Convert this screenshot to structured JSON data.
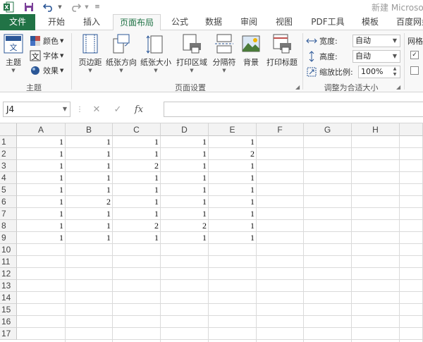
{
  "window": {
    "title": "新建 Microsoft"
  },
  "quick_access": {
    "app_icon": "excel-icon",
    "save_icon": "save-icon",
    "undo_icon": "undo-icon",
    "redo_icon": "redo-icon",
    "customize_icon": "customize-icon"
  },
  "tabs": [
    {
      "label": "文件"
    },
    {
      "label": "开始"
    },
    {
      "label": "插入"
    },
    {
      "label": "页面布局"
    },
    {
      "label": "公式"
    },
    {
      "label": "数据"
    },
    {
      "label": "审阅"
    },
    {
      "label": "视图"
    },
    {
      "label": "PDF工具"
    },
    {
      "label": "模板"
    },
    {
      "label": "百度网盘"
    }
  ],
  "ribbon": {
    "themes": {
      "theme_label": "主题",
      "colors_label": "颜色",
      "fonts_label": "字体",
      "effects_label": "效果",
      "group_label": "主题"
    },
    "page_setup": {
      "margins_label": "页边距",
      "orientation_label": "纸张方向",
      "size_label": "纸张大小",
      "print_area_label": "打印区域",
      "breaks_label": "分隔符",
      "background_label": "背景",
      "print_titles_label": "打印标题",
      "group_label": "页面设置"
    },
    "scale_to_fit": {
      "width_label": "宽度:",
      "width_value": "自动",
      "height_label": "高度:",
      "height_value": "自动",
      "scale_label": "缩放比例:",
      "scale_value": "100%",
      "group_label": "调整为合适大小"
    },
    "sheet_options": {
      "gridlines_label": "网格"
    }
  },
  "formula_bar": {
    "name_box": "J4",
    "cancel_glyph": "✕",
    "enter_glyph": "✓",
    "fx_label": "fx",
    "formula": ""
  },
  "sheet": {
    "columns": [
      "A",
      "B",
      "C",
      "D",
      "E",
      "F",
      "G",
      "H"
    ],
    "rows": [
      "1",
      "2",
      "3",
      "4",
      "5",
      "6",
      "7",
      "8",
      "9",
      "10",
      "11",
      "12",
      "13",
      "14",
      "15",
      "16",
      "17"
    ],
    "cells": [
      [
        "1",
        "1",
        "1",
        "1",
        "1"
      ],
      [
        "1",
        "1",
        "1",
        "1",
        "2"
      ],
      [
        "1",
        "1",
        "2",
        "1",
        "1"
      ],
      [
        "1",
        "1",
        "1",
        "1",
        "1"
      ],
      [
        "1",
        "1",
        "1",
        "1",
        "1"
      ],
      [
        "1",
        "2",
        "1",
        "1",
        "1"
      ],
      [
        "1",
        "1",
        "1",
        "1",
        "1"
      ],
      [
        "1",
        "1",
        "2",
        "2",
        "1"
      ],
      [
        "1",
        "1",
        "1",
        "1",
        "1"
      ]
    ]
  },
  "colors": {
    "brand": "#217346",
    "grid_line": "#dadada",
    "header_bg": "#f3f3f3"
  }
}
